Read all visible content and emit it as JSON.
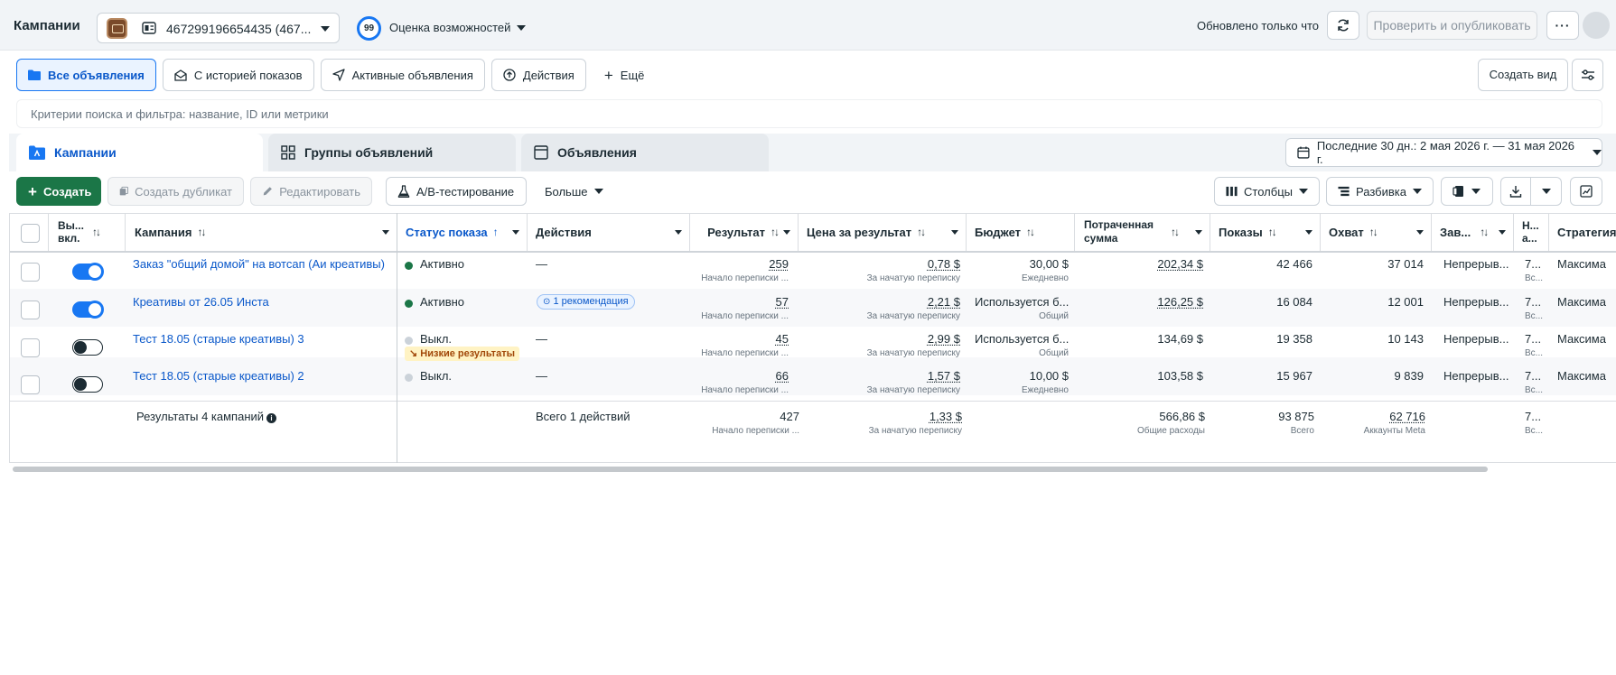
{
  "header": {
    "title": "Кампании",
    "account_label": "467299196654435 (467...",
    "score_value": "99",
    "score_label": "Оценка возможностей",
    "updated_text": "Обновлено только что",
    "publish_label": "Проверить и опубликовать",
    "more_label": "···"
  },
  "filters": {
    "all_ads": "Все объявления",
    "with_history": "С историей показов",
    "active_ads": "Активные объявления",
    "actions": "Действия",
    "more": "Ещё",
    "create_view": "Создать вид"
  },
  "search": {
    "placeholder": "Критерии поиска и фильтра: название, ID или метрики"
  },
  "level_tabs": {
    "campaigns": "Кампании",
    "ad_sets": "Группы объявлений",
    "ads": "Объявления"
  },
  "date_range": "Последние 30 дн.: 2 мая 2026 г. — 31 мая 2026 г.",
  "toolbar": {
    "create": "Создать",
    "duplicate": "Создать дубликат",
    "edit": "Редактировать",
    "ab_test": "A/B-тестирование",
    "more": "Больше",
    "columns": "Столбцы",
    "breakdown": "Разбивка"
  },
  "columns": {
    "toggle": "Вы... вкл.",
    "campaign": "Кампания",
    "status": "Статус показа",
    "actions": "Действия",
    "result": "Результат",
    "cost": "Цена за результат",
    "budget": "Бюджет",
    "spent": "Потраченная сумма",
    "impressions": "Показы",
    "reach": "Охват",
    "end": "Зав...",
    "attribution": "Н... а...",
    "strategy": "Стратегия"
  },
  "rows": [
    {
      "name": "Заказ \"общий домой\" на вотсап (Аи креативы)",
      "enabled": true,
      "status": "Активно",
      "status_color": "#1b7647",
      "status_warning": "",
      "actions": "—",
      "recommendation": "",
      "result": "259",
      "result_sub": "Начало переписки ...",
      "cost": "0,78 $",
      "cost_sub": "За начатую переписку",
      "budget": "30,00 $",
      "budget_sub": "Ежедневно",
      "spent": "202,34 $",
      "impressions": "42 466",
      "reach": "37 014",
      "end": "Непрерыв...",
      "attr": "7...",
      "attr_sub": "Вс...",
      "strategy": "Максима"
    },
    {
      "name": "Креативы от 26.05 Инста",
      "enabled": true,
      "status": "Активно",
      "status_color": "#1b7647",
      "status_warning": "",
      "actions": "",
      "recommendation": "1 рекомендация",
      "result": "57",
      "result_sub": "Начало переписки ...",
      "cost": "2,21 $",
      "cost_sub": "За начатую переписку",
      "budget": "Используется б...",
      "budget_sub": "Общий",
      "spent": "126,25 $",
      "impressions": "16 084",
      "reach": "12 001",
      "end": "Непрерыв...",
      "attr": "7...",
      "attr_sub": "Вс...",
      "strategy": "Максима"
    },
    {
      "name": "Тест 18.05 (старые креативы) 3",
      "enabled": false,
      "status": "Выкл.",
      "status_color": "#cbd2d9",
      "status_warning": "Низкие результаты",
      "actions": "—",
      "recommendation": "",
      "result": "45",
      "result_sub": "Начало переписки ...",
      "cost": "2,99 $",
      "cost_sub": "За начатую переписку",
      "budget": "Используется б...",
      "budget_sub": "Общий",
      "spent": "134,69 $",
      "impressions": "19 358",
      "reach": "10 143",
      "end": "Непрерыв...",
      "attr": "7...",
      "attr_sub": "Вс...",
      "strategy": "Максима"
    },
    {
      "name": "Тест 18.05 (старые креативы) 2",
      "enabled": false,
      "status": "Выкл.",
      "status_color": "#cbd2d9",
      "status_warning": "",
      "actions": "—",
      "recommendation": "",
      "result": "66",
      "result_sub": "Начало переписки ...",
      "cost": "1,57 $",
      "cost_sub": "За начатую переписку",
      "budget": "10,00 $",
      "budget_sub": "Ежедневно",
      "spent": "103,58 $",
      "impressions": "15 967",
      "reach": "9 839",
      "end": "Непрерыв...",
      "attr": "7...",
      "attr_sub": "Вс...",
      "strategy": "Максима"
    }
  ],
  "totals": {
    "label": "Результаты 4 кампаний",
    "actions": "Всего 1 действий",
    "result": "427",
    "result_sub": "Начало переписки ...",
    "cost": "1,33 $",
    "cost_sub": "За начатую переписку",
    "spent": "566,86 $",
    "spent_sub": "Общие расходы",
    "impressions": "93 875",
    "impressions_sub": "Всего",
    "reach": "62 716",
    "reach_sub": "Аккаунты Meta",
    "attr": "7...",
    "attr_sub": "Вс..."
  }
}
